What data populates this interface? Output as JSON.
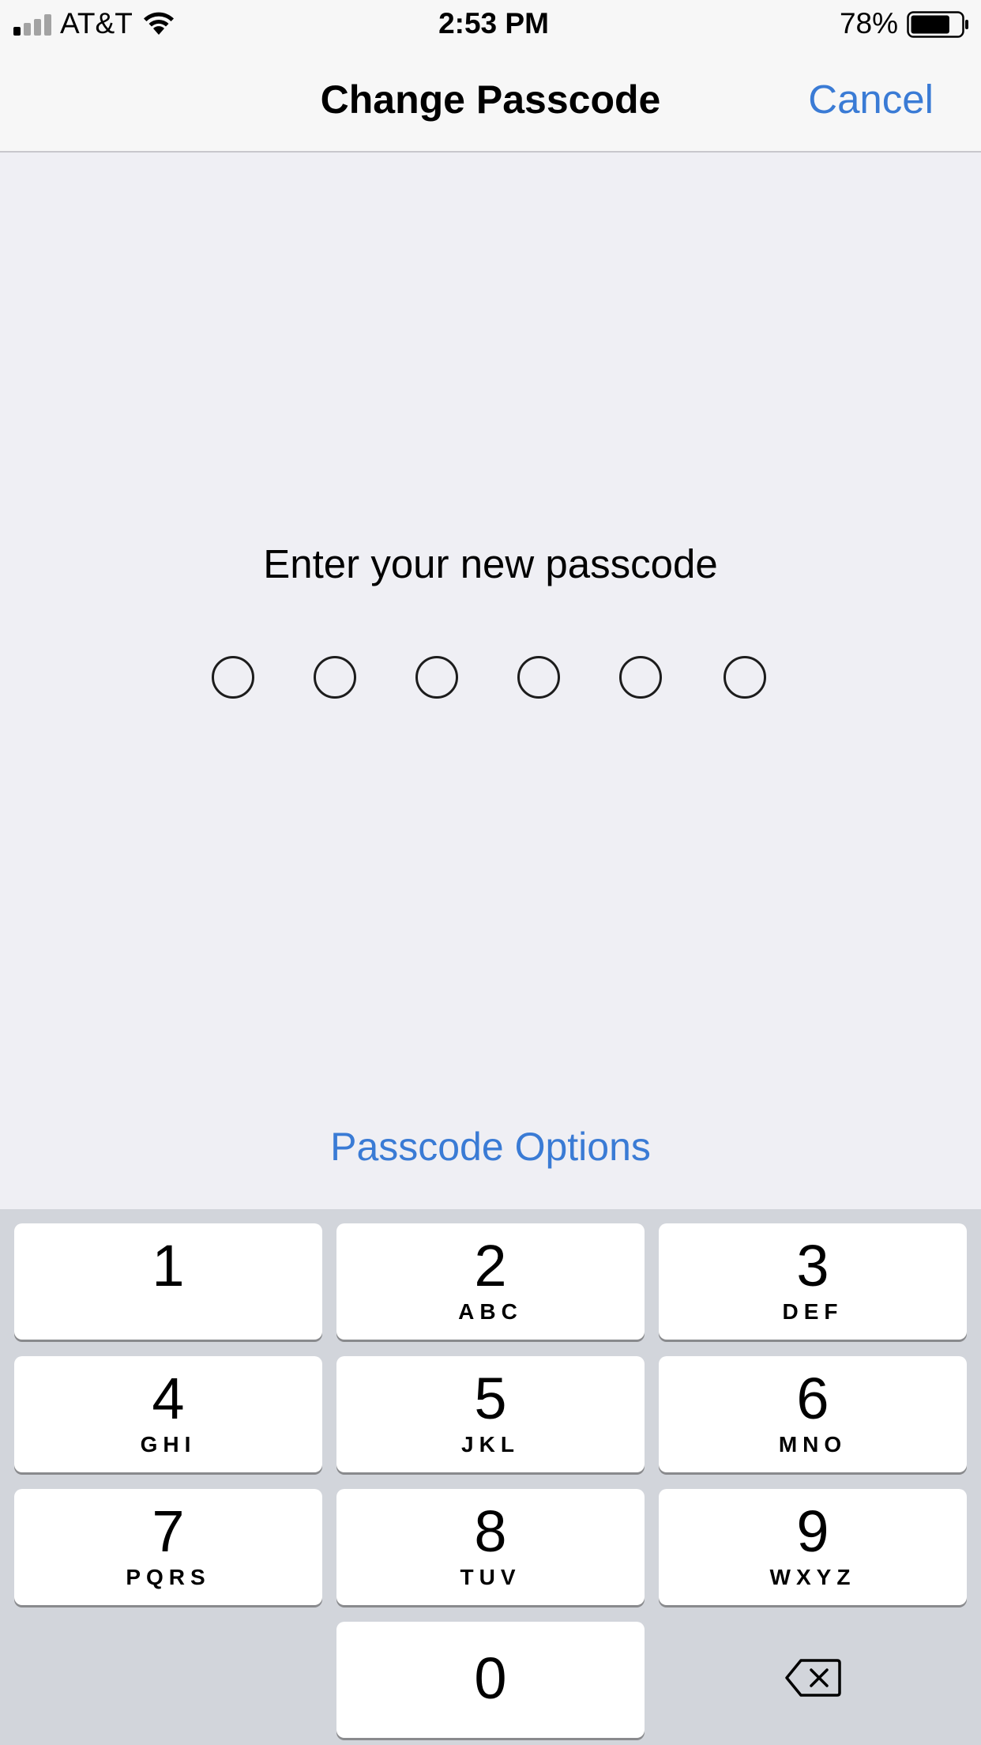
{
  "status_bar": {
    "carrier": "AT&T",
    "time": "2:53 PM",
    "battery_percent": "78%",
    "battery_level": 0.78,
    "signal_bars_filled": 1,
    "signal_bars_total": 4,
    "icons": [
      "signal-icon",
      "wifi-icon",
      "battery-icon"
    ]
  },
  "nav": {
    "title": "Change Passcode",
    "cancel_label": "Cancel"
  },
  "content": {
    "prompt": "Enter your new passcode",
    "digits_entered": 0,
    "digits_total": 6,
    "options_label": "Passcode Options"
  },
  "keypad": {
    "keys": [
      {
        "digit": "1",
        "letters": ""
      },
      {
        "digit": "2",
        "letters": "ABC"
      },
      {
        "digit": "3",
        "letters": "DEF"
      },
      {
        "digit": "4",
        "letters": "GHI"
      },
      {
        "digit": "5",
        "letters": "JKL"
      },
      {
        "digit": "6",
        "letters": "MNO"
      },
      {
        "digit": "7",
        "letters": "PQRS"
      },
      {
        "digit": "8",
        "letters": "TUV"
      },
      {
        "digit": "9",
        "letters": "WXYZ"
      },
      {
        "digit": "0",
        "letters": ""
      }
    ],
    "delete_icon": "delete-backspace-icon"
  },
  "colors": {
    "accent": "#3a7bd5",
    "background": "#efeff4",
    "keypad_background": "#d2d5db",
    "key_background": "#ffffff"
  }
}
